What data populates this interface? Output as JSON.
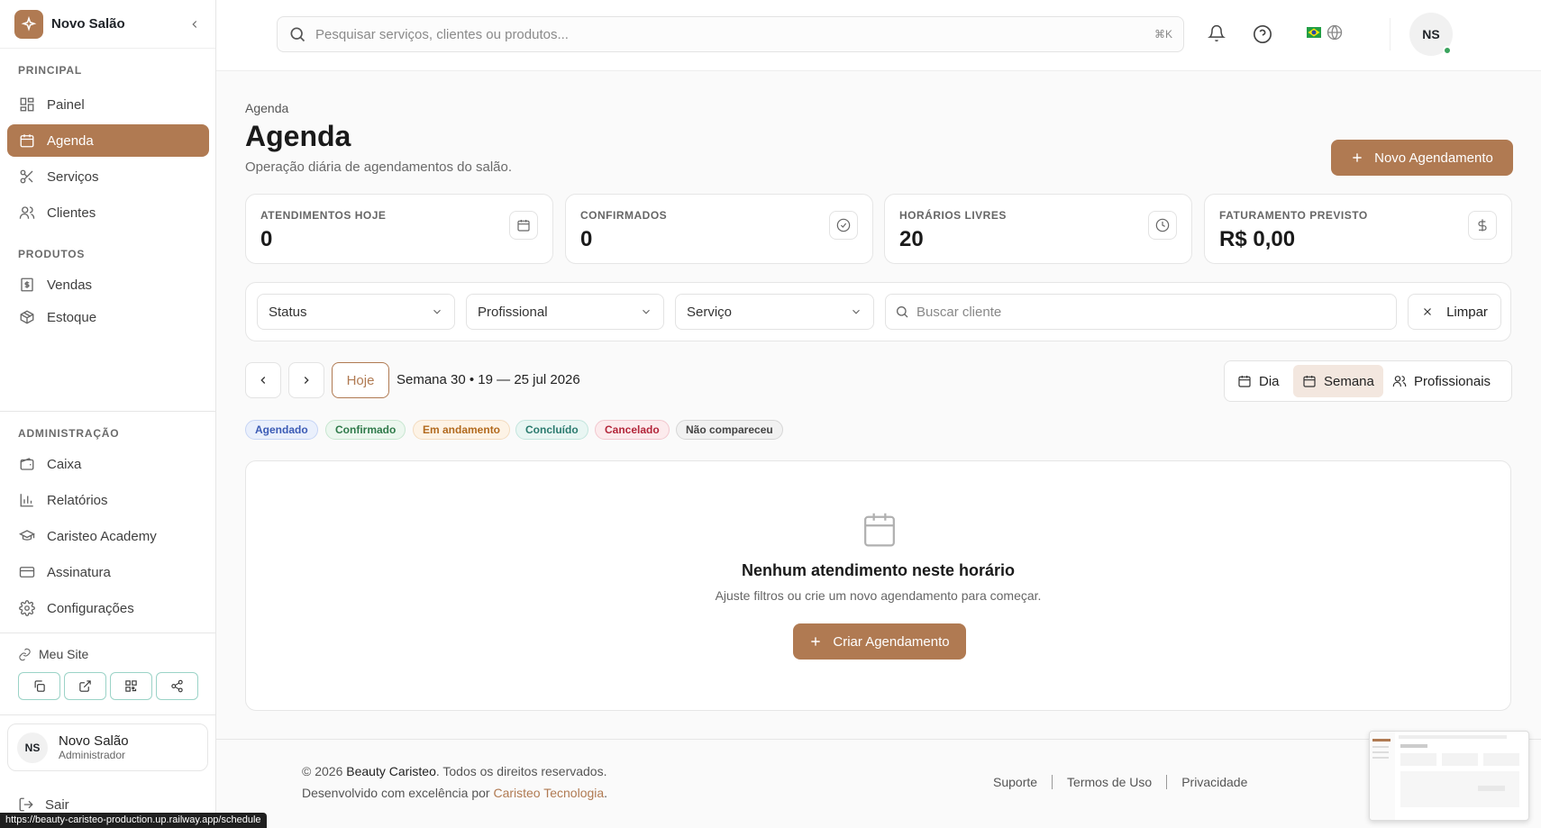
{
  "sidebar": {
    "brand": "Novo Salão",
    "section_principal": "PRINCIPAL",
    "section_produtos": "PRODUTOS",
    "section_admin": "ADMINISTRAÇÃO",
    "principal": [
      {
        "label": "Painel",
        "icon": "grid-icon"
      },
      {
        "label": "Agenda",
        "icon": "calendar-icon",
        "active": true
      },
      {
        "label": "Serviços",
        "icon": "scissors-icon"
      },
      {
        "label": "Clientes",
        "icon": "users-icon"
      }
    ],
    "produtos": [
      {
        "label": "Vendas",
        "icon": "receipt-icon"
      },
      {
        "label": "Estoque",
        "icon": "package-icon"
      }
    ],
    "admin": [
      {
        "label": "Caixa",
        "icon": "wallet-icon"
      },
      {
        "label": "Relatórios",
        "icon": "bar-chart-icon"
      },
      {
        "label": "Caristeo Academy",
        "icon": "graduation-cap-icon"
      },
      {
        "label": "Assinatura",
        "icon": "credit-card-icon"
      },
      {
        "label": "Configurações",
        "icon": "gear-icon"
      }
    ],
    "site_label": "Meu Site",
    "user": {
      "initials": "NS",
      "name": "Novo Salão",
      "role": "Administrador"
    },
    "logout": "Sair"
  },
  "topbar": {
    "search_placeholder": "Pesquisar serviços, clientes ou produtos...",
    "shortcut": "⌘K",
    "avatar_initials": "NS"
  },
  "page": {
    "breadcrumb": "Agenda",
    "title": "Agenda",
    "subtitle": "Operação diária de agendamentos do salão.",
    "new_button": "Novo Agendamento"
  },
  "stats": [
    {
      "label": "ATENDIMENTOS HOJE",
      "value": "0",
      "icon": "calendar-icon"
    },
    {
      "label": "CONFIRMADOS",
      "value": "0",
      "icon": "check-circle-icon"
    },
    {
      "label": "HORÁRIOS LIVRES",
      "value": "20",
      "icon": "clock-icon"
    },
    {
      "label": "FATURAMENTO PREVISTO",
      "value": "R$ 0,00",
      "icon": "dollar-icon"
    }
  ],
  "filters": {
    "status": "Status",
    "profissional": "Profissional",
    "servico": "Serviço",
    "client_placeholder": "Buscar cliente",
    "clear": "Limpar"
  },
  "calendar": {
    "today": "Hoje",
    "week": "Semana 30 • 19 — 25 jul 2026",
    "views": [
      "Dia",
      "Semana",
      "Profissionais"
    ],
    "active_view": "Semana"
  },
  "legend": [
    {
      "label": "Agendado",
      "color": "#3b5bb5",
      "bg": "#eaf0fc",
      "border": "#c7d5f5"
    },
    {
      "label": "Confirmado",
      "color": "#2f7a4a",
      "bg": "#ecf7ef",
      "border": "#c7e6d0"
    },
    {
      "label": "Em andamento",
      "color": "#b26a1e",
      "bg": "#fdf3e6",
      "border": "#f3dcc0"
    },
    {
      "label": "Concluído",
      "color": "#2a7a6e",
      "bg": "#e9f6f3",
      "border": "#c3e5dd"
    },
    {
      "label": "Cancelado",
      "color": "#b3263a",
      "bg": "#fcebed",
      "border": "#f2c7ce"
    },
    {
      "label": "Não compareceu",
      "color": "#444444",
      "bg": "#f1f1f1",
      "border": "#d6d6d6"
    }
  ],
  "empty": {
    "title": "Nenhum atendimento neste horário",
    "subtitle": "Ajuste filtros ou crie um novo agendamento para começar.",
    "button": "Criar Agendamento"
  },
  "footer": {
    "copyright_pre": "© 2026",
    "brand": "Beauty Caristeo",
    "copyright_post": ". Todos os direitos reservados.",
    "dev_pre": "Desenvolvido com excelência por",
    "dev_link": "Caristeo Tecnologia",
    "dev_post": ".",
    "links": [
      "Suporte",
      "Termos de Uso",
      "Privacidade"
    ]
  },
  "status_url": "https://beauty-caristeo-production.up.railway.app/schedule",
  "accent": "#b07a52"
}
